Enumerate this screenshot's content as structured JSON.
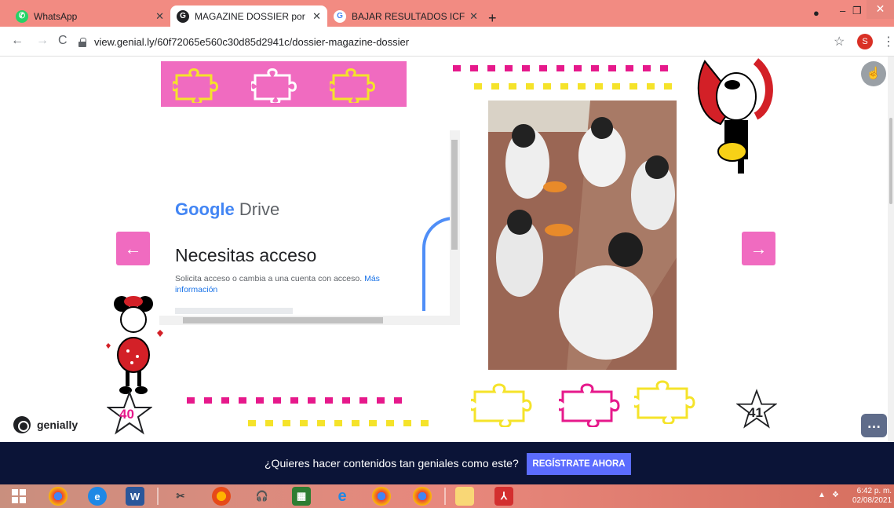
{
  "browser": {
    "tabs": [
      {
        "title": "WhatsApp",
        "active": false,
        "icon": "whatsapp-icon"
      },
      {
        "title": "MAGAZINE DOSSIER por sandra",
        "active": true,
        "icon": "genially-icon"
      },
      {
        "title": "BAJAR RESULTADOS ICFES - Bus",
        "active": false,
        "icon": "google-icon"
      }
    ],
    "new_tab": "+",
    "url": "view.genial.ly/60f72065e560c30d85d2941c/dossier-magazine-dossier",
    "profile_initial": "S"
  },
  "slide": {
    "embed": {
      "logo_google": "Google",
      "logo_drive": "Drive",
      "heading": "Necesitas acceso",
      "description": "Solicita acceso o cambia a una cuenta con acceso.",
      "link": "Más información"
    },
    "left_page_number": "40",
    "right_page_number": "41",
    "prev_arrow": "←",
    "next_arrow": "→",
    "brand": "genially",
    "colors": {
      "pink": "#f06bc0",
      "yellow": "#f5e32a",
      "magenta": "#e6198b"
    }
  },
  "cta": {
    "text": "¿Quieres hacer contenidos tan geniales como este?",
    "button": "REGÍSTRATE AHORA"
  },
  "taskbar": {
    "time": "6:42 p. m.",
    "date": "02/08/2021"
  }
}
